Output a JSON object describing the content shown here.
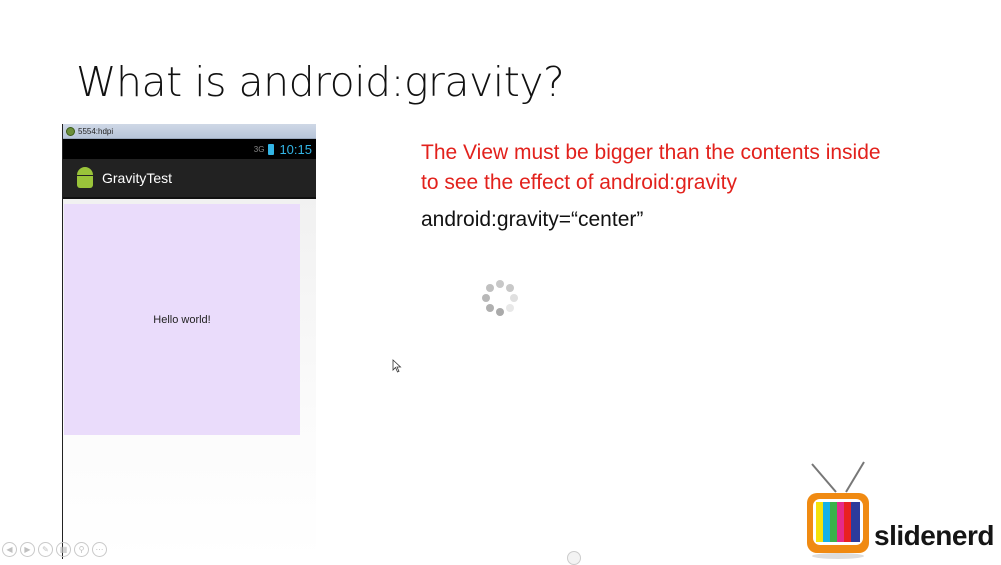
{
  "slide": {
    "title": "What is android:gravity?",
    "point_1_line1": "The View must be bigger than the contents inside",
    "point_1_line2": "to see the effect of android:gravity",
    "point_2": "android:gravity=“center”",
    "accent_red": "#e2211c"
  },
  "emulator": {
    "window_title": "5554:hdpi",
    "signal_label": "3G",
    "clock": "10:15",
    "app_name": "GravityTest",
    "view_text": "Hello world!",
    "view_color": "#eadcfb"
  },
  "branding": {
    "logo_text": "slidenerd"
  },
  "icons": [
    "android-app-icon",
    "loading-spinner-icon",
    "mouse-cursor-icon",
    "tv-logo-icon"
  ]
}
